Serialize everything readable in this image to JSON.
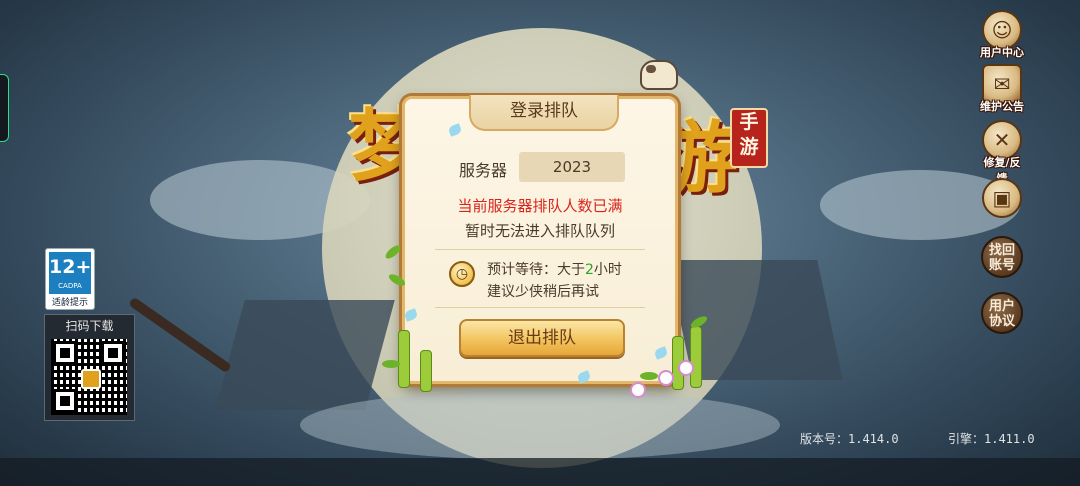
{
  "logo": {
    "left_glyph": "梦",
    "right_glyph": "游",
    "seal_line1": "手",
    "seal_line2": "游"
  },
  "age_rating": {
    "age": "12+",
    "org": "CADPA",
    "tip": "适龄提示"
  },
  "qr": {
    "title": "扫码下载"
  },
  "side_menu": {
    "user_center": "用户中心",
    "maintenance_notice": "维护公告",
    "repair_feedback": "修复/反馈",
    "find_account_1": "找回",
    "find_account_2": "账号",
    "user_agreement_1": "用户",
    "user_agreement_2": "协议"
  },
  "dialog": {
    "title": "登录排队",
    "server_label": "服务器",
    "server_value": "2023",
    "queue_full_msg": "当前服务器排队人数已满",
    "cannot_join_msg": "暂时无法进入排队队列",
    "wait_prefix": "预计等待：大于",
    "wait_number": "2",
    "wait_suffix": "小时",
    "suggestion": "建议少侠稍后再试",
    "exit_button": "退出排队"
  },
  "version": {
    "client": "版本号：1.414.0",
    "engine": "引擎：1.411.0"
  },
  "colors": {
    "accent_gold": "#e6a63a",
    "warning_red": "#d8241c",
    "wait_green": "#2aa32a",
    "dialog_bg": "#fdf6e6"
  },
  "icons": [
    "user-center-icon",
    "notice-scroll-icon",
    "wrench-icon",
    "layout-icon",
    "clock-icon"
  ]
}
